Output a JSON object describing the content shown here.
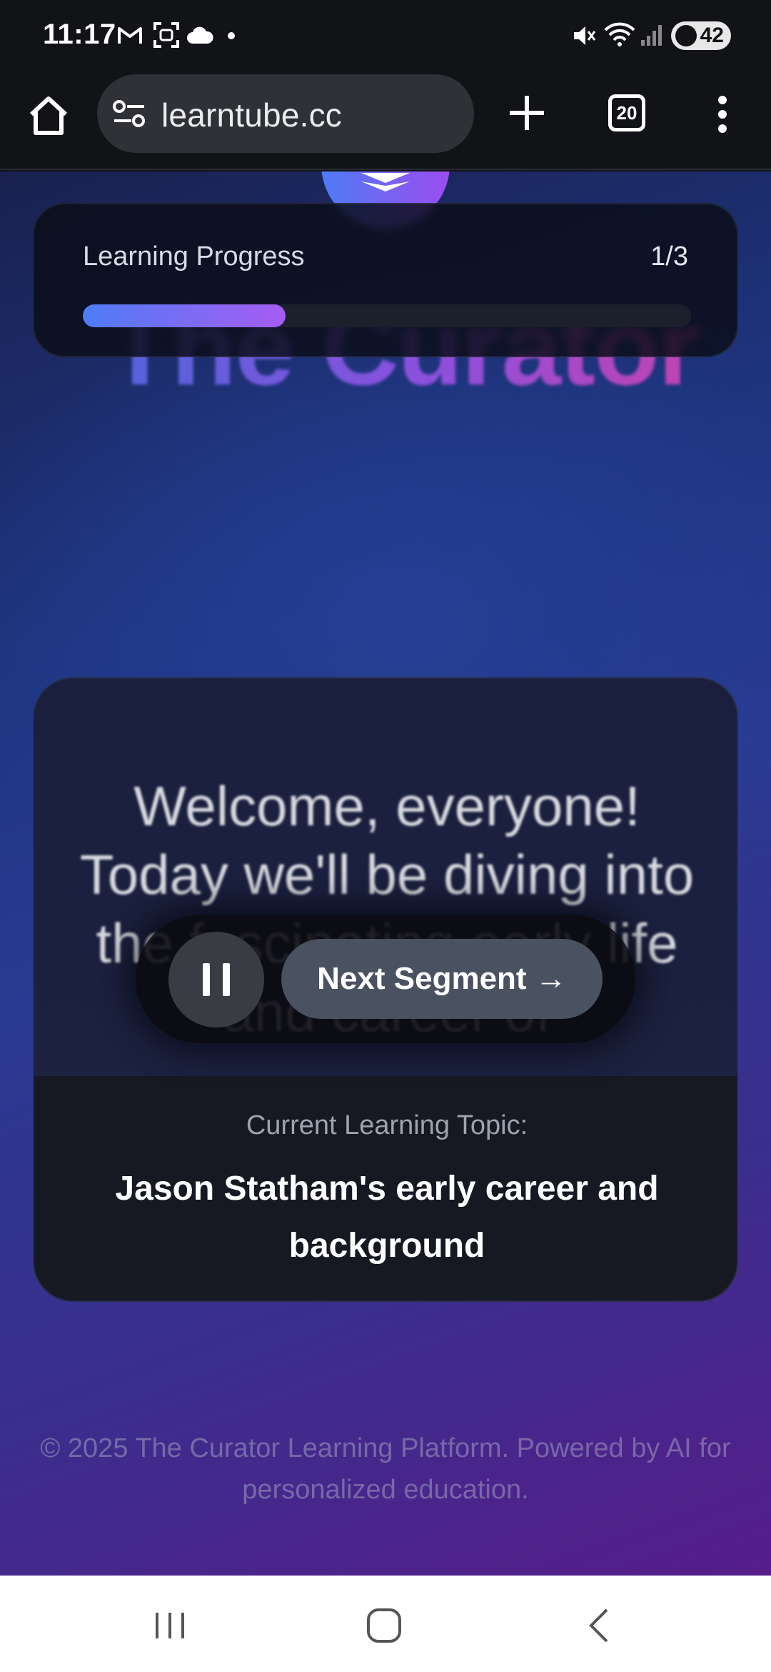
{
  "status_bar": {
    "time": "11:17",
    "battery": "42",
    "icons_left": [
      "gmail-icon",
      "screenshot-icon",
      "cloud-icon",
      "dot-icon"
    ],
    "icons_right": [
      "mute-icon",
      "wifi-icon",
      "signal-icon",
      "battery-icon"
    ]
  },
  "browser": {
    "url": "learntube.cc",
    "tab_count": "20"
  },
  "page": {
    "background_title": "The Curator",
    "progress": {
      "label": "Learning Progress",
      "count": "1/3",
      "fraction": 0.333
    },
    "segment": {
      "text": "Welcome, everyone! Today we'll be diving into the fascinating early life and career of"
    },
    "controls": {
      "next_label": "Next Segment →"
    },
    "topic": {
      "label": "Current Learning Topic:",
      "title": "Jason Statham's early career and background"
    },
    "footer": "© 2025 The Curator Learning Platform. Powered by AI for personalized education."
  },
  "colors": {
    "accent_start": "#4f7cf6",
    "accent_end": "#a65cf2"
  }
}
